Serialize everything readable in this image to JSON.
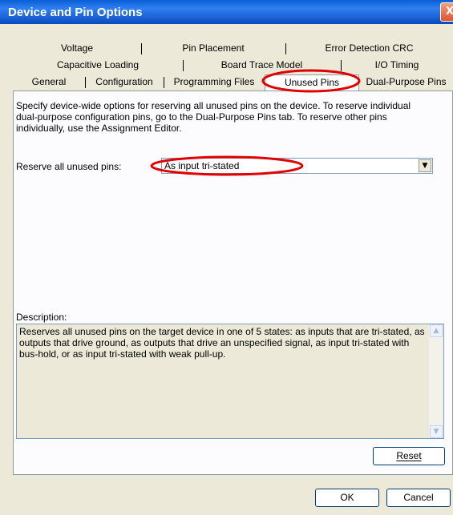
{
  "window": {
    "title": "Device and Pin Options",
    "close_glyph": "X"
  },
  "tabs": {
    "row1": [
      "Voltage",
      "Pin Placement",
      "Error Detection CRC"
    ],
    "row2": [
      "Capacitive Loading",
      "Board Trace Model",
      "I/O Timing"
    ],
    "row3": [
      "General",
      "Configuration",
      "Programming Files",
      "Unused Pins",
      "Dual-Purpose Pins"
    ],
    "active": "Unused Pins"
  },
  "panel": {
    "intro": "Specify device-wide options for reserving all unused pins on the device. To reserve individual dual-purpose configuration pins, go to the Dual-Purpose Pins tab. To reserve other pins individually, use the Assignment Editor.",
    "reserve_label": "Reserve all unused pins:",
    "reserve_value": "As input tri-stated",
    "description_label": "Description:",
    "description_text": "Reserves all unused pins on the target device in one of 5 states: as inputs that are tri-stated, as outputs that drive ground, as outputs that drive an unspecified signal, as input tri-stated with bus-hold, or as input tri-stated with weak pull-up.",
    "reset_label": "Reset"
  },
  "buttons": {
    "ok": "OK",
    "cancel": "Cancel"
  },
  "colors": {
    "highlight_ellipse": "#e00000",
    "title_bar": "#1d64d8"
  }
}
